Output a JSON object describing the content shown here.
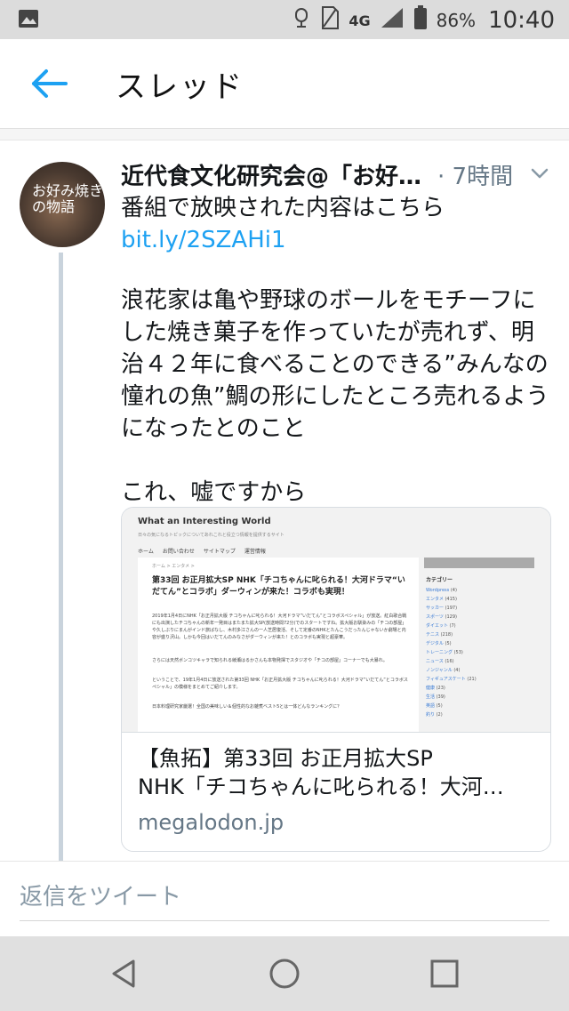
{
  "status_bar": {
    "network": "4G",
    "battery": "86%",
    "time": "10:40"
  },
  "app_bar": {
    "title": "スレッド"
  },
  "tweet": {
    "author": "近代食文化研究会@「お好…",
    "time": "· 7時間",
    "line1": "番組で放映された内容はこちら",
    "link": "bit.ly/2SZAHi1",
    "para1": "浪花家は亀や野球のボールをモチーフにした焼き菓子を作っていたが売れず、明治４２年に食べることのできる”みんなの憧れの魚”鯛の形にしたところ売れるようになったとのこと",
    "para2": "これ、嘘ですから",
    "avatar_text": "お好み焼きの物語"
  },
  "card": {
    "site_title": "What an Interesting World",
    "site_tagline": "日々の気になるトピックについてあれこれと役立つ情報を提供するサイト",
    "nav": [
      "ホーム",
      "お問い合わせ",
      "サイトマップ",
      "運営情報"
    ],
    "breadcrumb": "ホーム > エンタメ >",
    "article_title": "第33回 お正月拡大SP NHK「チコちゃんに叱られる！大河ドラマ“いだてん”とコラボ」ダーウィンが来た！コラボも実現！",
    "paragraphs": [
      "2019年1月4日にNHK「お正月拡大版 チコちゃんに叱られる！大河ドラマ”いだてん”とコラボスペシャル」が放送。紅白歌合戦にも出演したチコちゃんの新年一発目はまたまた拡大SP(放送時間72分)でのスタートですね。拡大版お馴染みの「チコの部屋」や久しぶりにまんがインド旅ばなし、木村多江さんの一人芝居復活、そして定番のNHKとたんこうだったんじゃないか劇場と内容が盛り沢山。しかも今回はいだてんのみなさがダーウィンが来た！とのコラボも実現と超豪華。",
      "さらには天然ボンコツキャラで知られる綾瀬はるかさんも本物発揮でスタジオや「チコの部屋」コーナーでも大暴れ。",
      "ということで、19年1月4日に放送された第33回 NHK「お正月拡大版 チコちゃんに叱られる！大河ドラマ”いだてん”とコラボスペシャル」の模様をまとめてご紹介します。",
      "日本料理研究家厳選！全国の美味しい＆個性的なお雑煮ベスト5とは一体どんなランキングに？"
    ],
    "sidebar_heading": "カテゴリー",
    "categories": [
      {
        "name": "Wordpress",
        "count": "(4)"
      },
      {
        "name": "エンタメ",
        "count": "(415)"
      },
      {
        "name": "サッカー",
        "count": "(197)"
      },
      {
        "name": "スポーツ",
        "count": "(129)"
      },
      {
        "name": "ダイエット",
        "count": "(7)"
      },
      {
        "name": "テニス",
        "count": "(218)"
      },
      {
        "name": "デジタル",
        "count": "(5)"
      },
      {
        "name": "トレーニング",
        "count": "(53)"
      },
      {
        "name": "ニュース",
        "count": "(16)"
      },
      {
        "name": "ノンジャンル",
        "count": "(4)"
      },
      {
        "name": "フィギュアスケート",
        "count": "(21)"
      },
      {
        "name": "健康",
        "count": "(23)"
      },
      {
        "name": "生活",
        "count": "(39)"
      },
      {
        "name": "英語",
        "count": "(5)"
      },
      {
        "name": "釣り",
        "count": "(2)"
      }
    ],
    "title_line1": "【魚拓】第33回 お正月拡大SP",
    "title_line2": "NHK「チコちゃんに叱られる！大河…",
    "domain": "megalodon.jp"
  },
  "reply": {
    "placeholder": "返信をツイート"
  },
  "colors": {
    "link": "#1da1f2",
    "secondary_text": "#657786",
    "thread_line": "#c9d3dc",
    "status_bar_bg": "#dcdcdc",
    "nav_bar_bg": "#e0e0e0"
  },
  "icons": [
    "image-icon",
    "alarm-icon",
    "no-sim-icon",
    "signal-icon",
    "battery-icon",
    "back-arrow-icon",
    "chevron-down-icon",
    "nav-back-icon",
    "nav-home-icon",
    "nav-recents-icon"
  ]
}
